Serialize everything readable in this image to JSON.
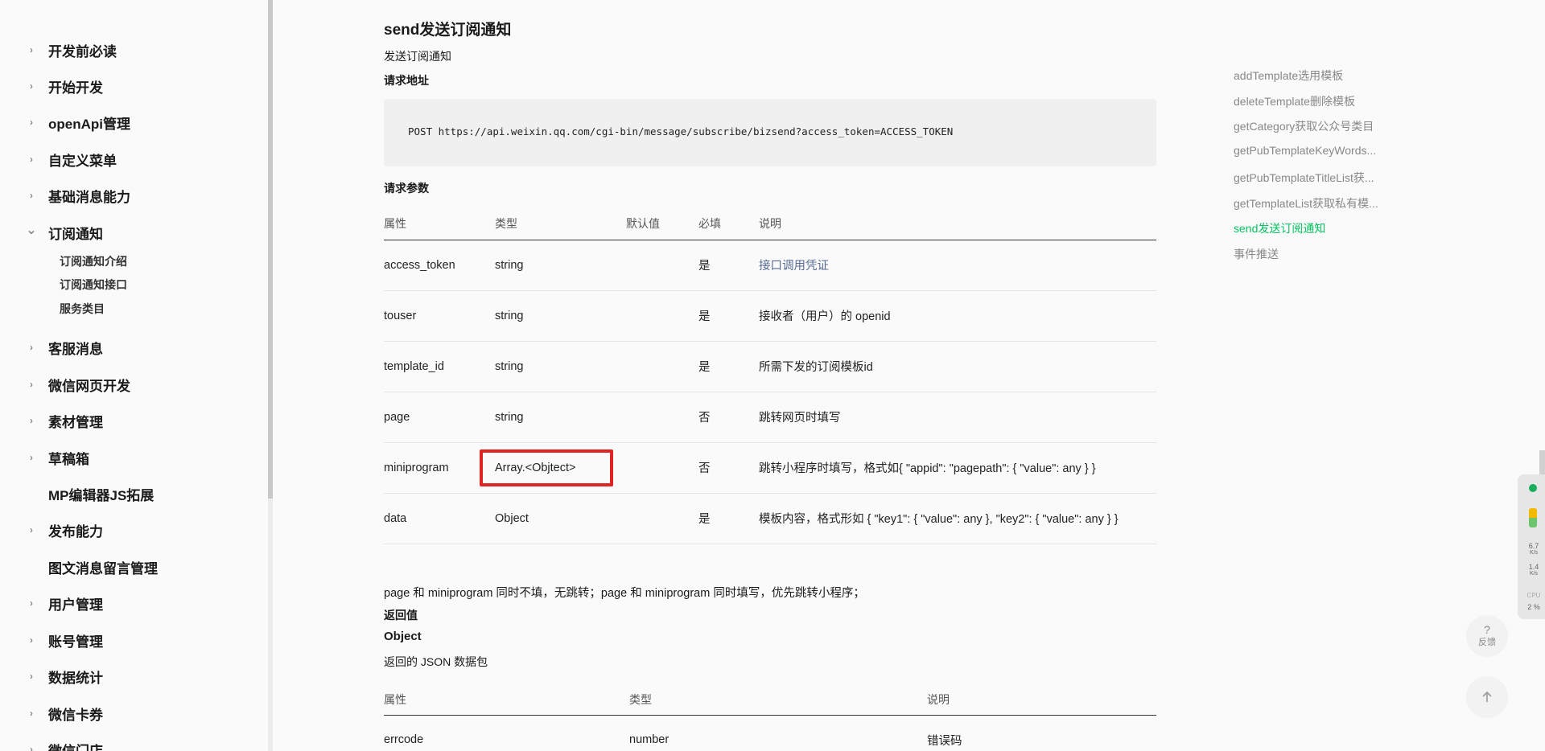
{
  "sidebar": {
    "items": [
      {
        "label": "开发前必读",
        "expand": "collapsed"
      },
      {
        "label": "开始开发",
        "expand": "collapsed"
      },
      {
        "label": "openApi管理",
        "expand": "collapsed"
      },
      {
        "label": "自定义菜单",
        "expand": "collapsed"
      },
      {
        "label": "基础消息能力",
        "expand": "collapsed"
      },
      {
        "label": "订阅通知",
        "expand": "expanded"
      },
      {
        "label": "客服消息",
        "expand": "collapsed"
      },
      {
        "label": "微信网页开发",
        "expand": "collapsed"
      },
      {
        "label": "素材管理",
        "expand": "collapsed"
      },
      {
        "label": "草稿箱",
        "expand": "collapsed"
      },
      {
        "label": "MP编辑器JS拓展",
        "expand": "none"
      },
      {
        "label": "发布能力",
        "expand": "collapsed"
      },
      {
        "label": "图文消息留言管理",
        "expand": "none"
      },
      {
        "label": "用户管理",
        "expand": "collapsed"
      },
      {
        "label": "账号管理",
        "expand": "collapsed"
      },
      {
        "label": "数据统计",
        "expand": "collapsed"
      },
      {
        "label": "微信卡券",
        "expand": "collapsed"
      },
      {
        "label": "微信门店",
        "expand": "collapsed"
      }
    ],
    "subitems": [
      "订阅通知介绍",
      "订阅通知接口",
      "服务类目"
    ]
  },
  "main": {
    "title": "send发送订阅通知",
    "desc": "发送订阅通知",
    "request_url_label": "请求地址",
    "request_url": "POST https://api.weixin.qq.com/cgi-bin/message/subscribe/bizsend?access_token=ACCESS_TOKEN",
    "params_label": "请求参数",
    "params_headers": [
      "属性",
      "类型",
      "默认值",
      "必填",
      "说明"
    ],
    "params_rows": [
      [
        "access_token",
        "string",
        "",
        "是",
        "接口调用凭证"
      ],
      [
        "touser",
        "string",
        "",
        "是",
        "接收者（用户）的 openid"
      ],
      [
        "template_id",
        "string",
        "",
        "是",
        "所需下发的订阅模板id"
      ],
      [
        "page",
        "string",
        "",
        "否",
        "跳转网页时填写"
      ],
      [
        "miniprogram",
        "Array.<Objtect>",
        "",
        "否",
        "跳转小程序时填写，格式如{ \"appid\": \"pagepath\": { \"value\": any } }"
      ],
      [
        "data",
        "Object",
        "",
        "是",
        "模板内容，格式形如 { \"key1\": { \"value\": any }, \"key2\": { \"value\": any } }"
      ]
    ],
    "note": "page 和 miniprogram 同时不填，无跳转；page 和 miniprogram 同时填写，优先跳转小程序；",
    "return_label": "返回值",
    "return_type": "Object",
    "return_desc": "返回的 JSON 数据包",
    "return_headers": [
      "属性",
      "类型",
      "说明"
    ],
    "return_rows": [
      [
        "errcode",
        "number",
        "错误码"
      ]
    ]
  },
  "toc": {
    "items": [
      "addTemplate选用模板",
      "deleteTemplate删除模板",
      "getCategory获取公众号类目",
      "getPubTemplateKeyWords...",
      "getPubTemplateTitleList获...",
      "getTemplateList获取私有模...",
      "send发送订阅通知",
      "事件推送"
    ],
    "active_index": 6
  },
  "widgets": {
    "feedback_label": "反馈",
    "feedback_glyph": "?",
    "top_glyph": "↑",
    "net_up": "6.7",
    "net_up_unit": "K/s",
    "net_down": "1.4",
    "net_down_unit": "K/s",
    "cpu_label": "CPU",
    "cpu_value": "2 %"
  }
}
